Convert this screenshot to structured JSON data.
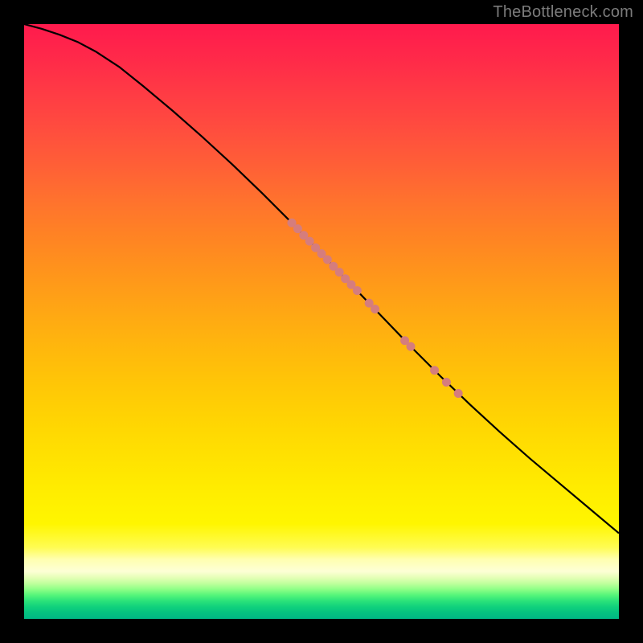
{
  "watermark": "TheBottleneck.com",
  "chart_data": {
    "type": "line",
    "title": "",
    "xlabel": "",
    "ylabel": "",
    "xlim": [
      0,
      100
    ],
    "ylim": [
      0,
      100
    ],
    "grid": false,
    "legend": false,
    "background": "heat-gradient (red→yellow→white→green, top→bottom)",
    "series": [
      {
        "name": "curve",
        "stroke": "#000000",
        "x": [
          0,
          3,
          6,
          9,
          12,
          16,
          20,
          25,
          30,
          35,
          40,
          45,
          50,
          55,
          60,
          65,
          70,
          75,
          80,
          85,
          90,
          95,
          100
        ],
        "y": [
          100,
          99.2,
          98.2,
          97.0,
          95.4,
          92.8,
          89.6,
          85.4,
          81.0,
          76.4,
          71.6,
          66.6,
          61.4,
          56.2,
          51.0,
          45.8,
          40.8,
          36.0,
          31.4,
          27.0,
          22.8,
          18.6,
          14.4
        ]
      }
    ],
    "points": {
      "name": "markers-on-curve",
      "color": "#d57d7d",
      "radius": 5.5,
      "x": [
        45,
        46,
        47,
        48,
        49,
        50,
        51,
        52,
        53,
        54,
        55,
        56,
        58,
        59,
        64,
        65,
        69,
        71,
        73
      ],
      "y": [
        66.6,
        65.6,
        64.5,
        63.5,
        62.4,
        61.4,
        60.4,
        59.3,
        58.3,
        57.2,
        56.2,
        55.2,
        53.1,
        52.1,
        46.8,
        45.8,
        41.8,
        39.8,
        37.9
      ]
    }
  }
}
